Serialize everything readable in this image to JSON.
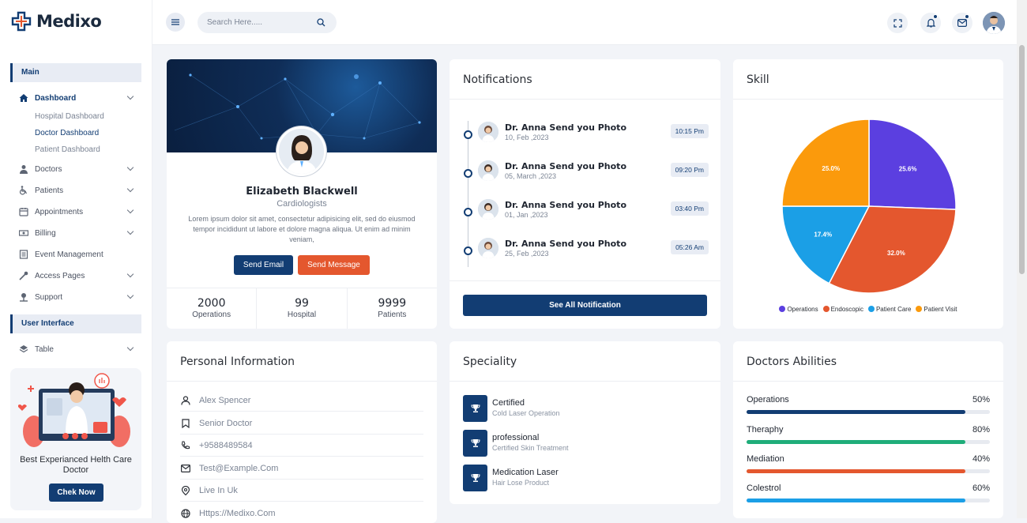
{
  "brand": {
    "name": "Medixo"
  },
  "sidebar": {
    "section_main": "Main",
    "section_ui": "User Interface",
    "dashboard": "Dashboard",
    "sub_items": [
      "Hospital Dashboard",
      "Doctor Dashboard",
      "Patient Dashboard"
    ],
    "items": [
      "Doctors",
      "Patients",
      "Appointments",
      "Billing",
      "Event Management",
      "Access Pages",
      "Support"
    ],
    "table": "Table",
    "promo_text": "Best Experianced Helth Care Doctor",
    "promo_button": "Chek Now"
  },
  "topbar": {
    "search_placeholder": "Search Here....."
  },
  "profile": {
    "name": "Elizabeth Blackwell",
    "role": "Cardiologists",
    "description": "Lorem ipsum dolor sit amet, consectetur adipisicing elit, sed do eiusmod tempor incididunt ut labore et dolore magna aliqua. Ut enim ad minim veniam,",
    "send_email": "Send Email",
    "send_message": "Send Message",
    "stats": [
      {
        "value": "2000",
        "label": "Operations"
      },
      {
        "value": "99",
        "label": "Hospital"
      },
      {
        "value": "9999",
        "label": "Patients"
      }
    ]
  },
  "notifications": {
    "title": "Notifications",
    "items": [
      {
        "text": "Dr. Anna Send you Photo",
        "date": "10, Feb ,2023",
        "time": "10:15 Pm"
      },
      {
        "text": "Dr. Anna Send you Photo",
        "date": "05, March ,2023",
        "time": "09:20 Pm"
      },
      {
        "text": "Dr. Anna Send you Photo",
        "date": "01, Jan ,2023",
        "time": "03:40 Pm"
      },
      {
        "text": "Dr. Anna Send you Photo",
        "date": "25, Feb ,2023",
        "time": "05:26 Am"
      }
    ],
    "see_all": "See All Notification"
  },
  "skill": {
    "title": "Skill"
  },
  "chart_data": {
    "type": "pie",
    "categories": [
      "Operations",
      "Endoscopic",
      "Patient Care",
      "Patient Visit"
    ],
    "values": [
      25.6,
      32.0,
      17.4,
      25.0
    ],
    "labels": [
      "25.6%",
      "32.0%",
      "17.4%",
      "25.0%"
    ],
    "colors": [
      "#5b3fe0",
      "#e4572e",
      "#1b9fe6",
      "#fb9a0c"
    ],
    "legend_position": "bottom"
  },
  "personal": {
    "title": "Personal Information",
    "rows": [
      "Alex Spencer",
      "Senior Doctor",
      "+9588489584",
      "Test@Example.Com",
      "Live In Uk",
      "Https://Medixo.Com"
    ]
  },
  "speciality": {
    "title": "Speciality",
    "items": [
      {
        "title": "Certified",
        "subtitle": "Cold Laser Operation"
      },
      {
        "title": "professional",
        "subtitle": "Certified Skin Treatment"
      },
      {
        "title": "Medication Laser",
        "subtitle": "Hair Lose Product"
      }
    ]
  },
  "abilities": {
    "title": "Doctors Abilities",
    "items": [
      {
        "label": "Operations",
        "value": "50%",
        "level": 0.9,
        "color": "#123d73"
      },
      {
        "label": "Theraphy",
        "value": "80%",
        "level": 0.9,
        "color": "#1fad7a"
      },
      {
        "label": "Mediation",
        "value": "40%",
        "level": 0.9,
        "color": "#e4572e"
      },
      {
        "label": "Colestrol",
        "value": "60%",
        "level": 0.9,
        "color": "#1b9fe6"
      }
    ]
  }
}
